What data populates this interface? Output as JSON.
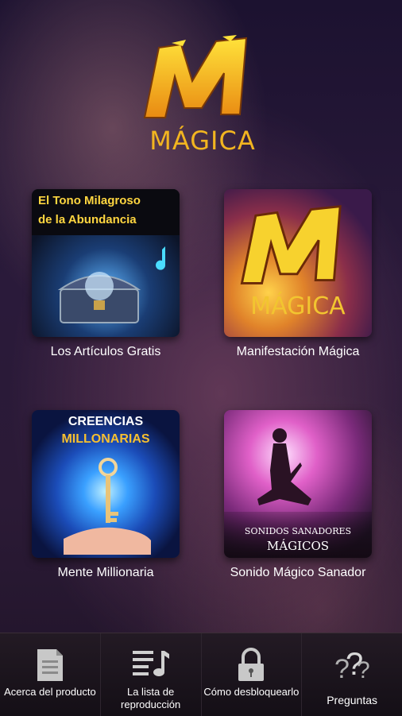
{
  "logo": {
    "word": "MÁGICA"
  },
  "tiles": [
    {
      "label": "Los Artículos Gratis",
      "title_line1": "El Tono Milagroso",
      "title_line2": "de la Abundancia"
    },
    {
      "label": "Manifestación Mágica",
      "word": "MÁGICA"
    },
    {
      "label": "Mente Millionaria",
      "title_line1": "CREENCIAS",
      "title_line2": "MILLONARIAS"
    },
    {
      "label": "Sonido Mágico Sanador",
      "title_line1": "SONIDOS SANADORES",
      "title_line2": "MÁGICOS"
    }
  ],
  "nav": [
    {
      "label": "Acerca del producto",
      "icon": "document-icon"
    },
    {
      "label": "La lista de reproducción",
      "icon": "playlist-icon"
    },
    {
      "label": "Cómo desbloquearlo",
      "icon": "lock-icon"
    },
    {
      "label": "Preguntas",
      "icon": "question-icon"
    }
  ],
  "colors": {
    "accent": "#f2b520",
    "background": "#2a1a3a",
    "nav_bg": "#1a1419"
  }
}
